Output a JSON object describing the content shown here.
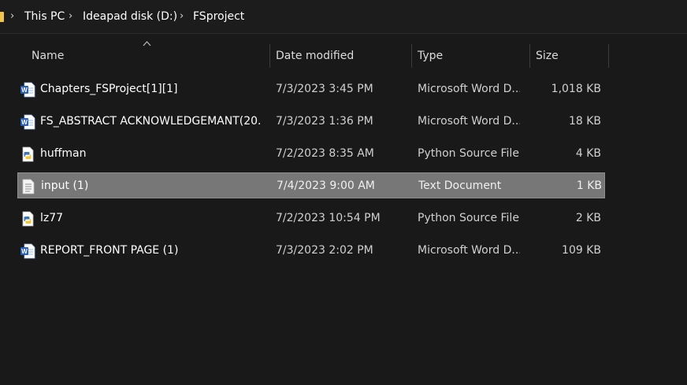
{
  "breadcrumb": {
    "items": [
      "This PC",
      "Ideapad disk (D:)",
      "FSproject"
    ],
    "separator": "›"
  },
  "columns": {
    "name": "Name",
    "date": "Date modified",
    "type": "Type",
    "size": "Size"
  },
  "files": [
    {
      "name": "Chapters_FSProject[1][1]",
      "date": "7/3/2023 3:45 PM",
      "type": "Microsoft Word D...",
      "size": "1,018 KB",
      "icon": "word-doc-icon",
      "selected": false
    },
    {
      "name": "FS_ABSTRACT ACKNOWLEDGEMANT(20...",
      "date": "7/3/2023 1:36 PM",
      "type": "Microsoft Word D...",
      "size": "18 KB",
      "icon": "word-doc-icon",
      "selected": false
    },
    {
      "name": "huffman",
      "date": "7/2/2023 8:35 AM",
      "type": "Python Source File",
      "size": "4 KB",
      "icon": "python-file-icon",
      "selected": false
    },
    {
      "name": "input (1)",
      "date": "7/4/2023 9:00 AM",
      "type": "Text Document",
      "size": "1 KB",
      "icon": "text-file-icon",
      "selected": true
    },
    {
      "name": "lz77",
      "date": "7/2/2023 10:54 PM",
      "type": "Python Source File",
      "size": "2 KB",
      "icon": "python-file-icon",
      "selected": false
    },
    {
      "name": "REPORT_FRONT PAGE (1)",
      "date": "7/3/2023 2:02 PM",
      "type": "Microsoft Word D...",
      "size": "109 KB",
      "icon": "word-doc-icon",
      "selected": false
    }
  ],
  "colors": {
    "background": "#191919",
    "selection": "#777777",
    "word_blue": "#2b5fb4",
    "folder_yellow": "#f1c34a"
  }
}
